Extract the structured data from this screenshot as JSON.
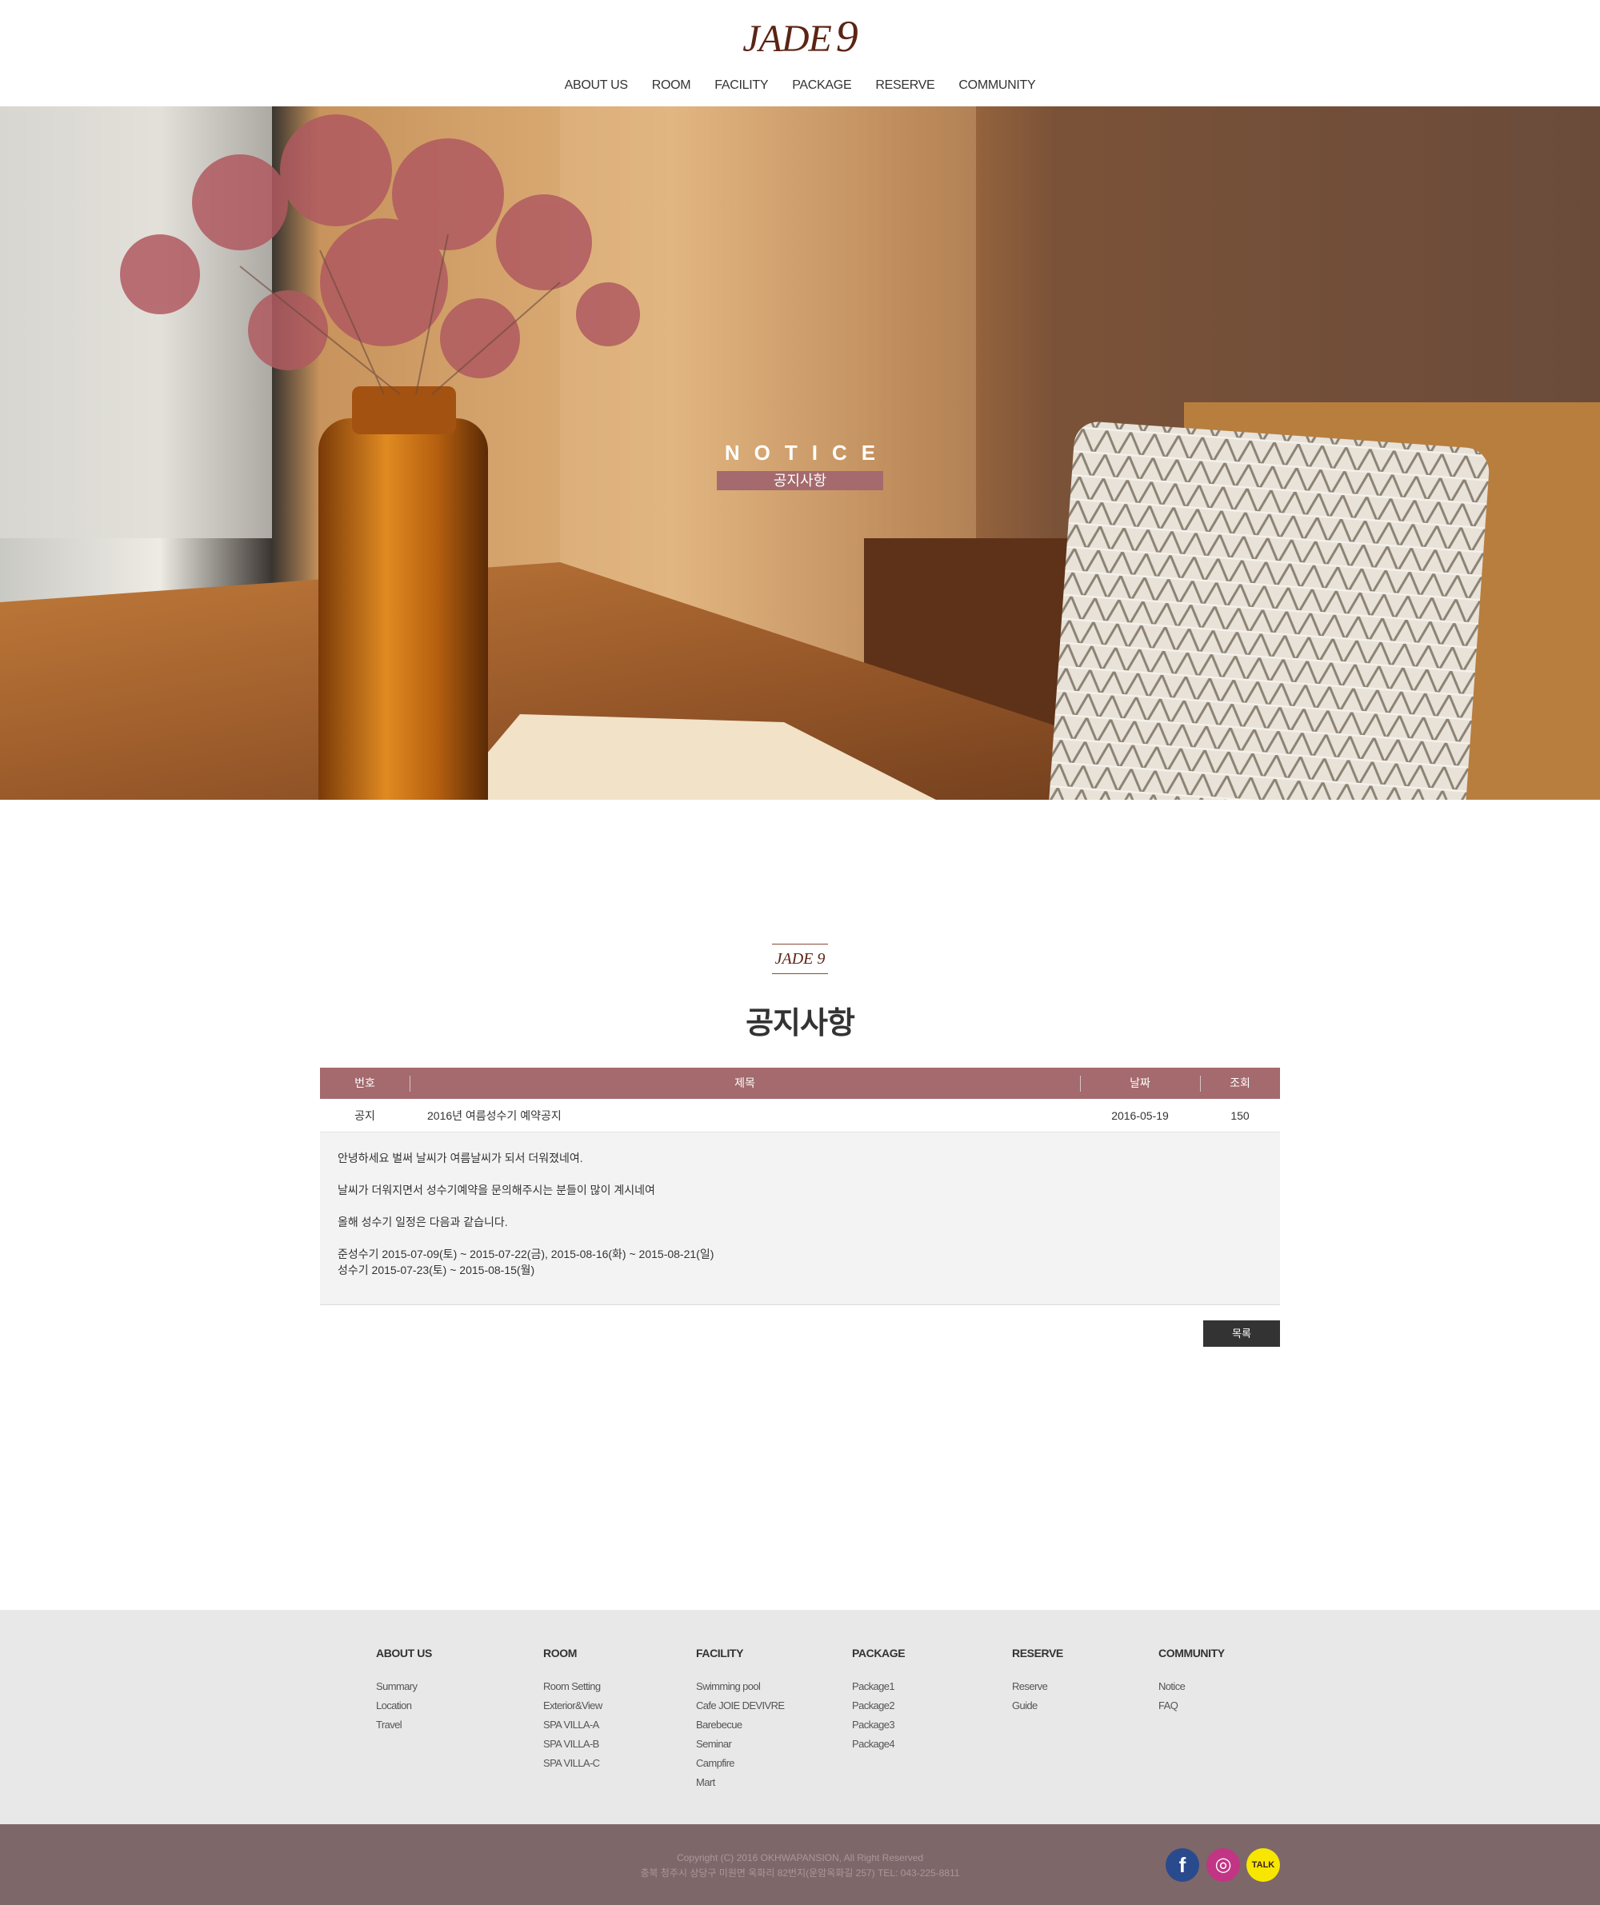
{
  "header": {
    "logo_text": "JADE",
    "logo_number": "9",
    "nav": [
      "ABOUT US",
      "ROOM",
      "FACILITY",
      "PACKAGE",
      "RESERVE",
      "COMMUNITY"
    ]
  },
  "hero": {
    "title": "NOTICE",
    "subtitle": "공지사항"
  },
  "section": {
    "mini_logo": "JADE 9",
    "title": "공지사항"
  },
  "board": {
    "headers": {
      "no": "번호",
      "subject": "제목",
      "date": "날짜",
      "views": "조회"
    },
    "row": {
      "no": "공지",
      "subject": "2016년 여름성수기  예약공지",
      "date": "2016-05-19",
      "views": "150"
    },
    "content": [
      "안녕하세요 벌써 날씨가 여름날씨가 되서 더워졌네여.",
      "날씨가 더워지면서 성수기예약을 문의해주시는 분들이 많이 계시네여",
      "올해 성수기 일정은 다음과 같습니다.",
      "준성수기 2015-07-09(토) ~ 2015-07-22(금), 2015-08-16(화) ~ 2015-08-21(일)",
      "성수기 2015-07-23(토) ~ 2015-08-15(월)"
    ],
    "list_button": "목록"
  },
  "footer": {
    "columns": [
      {
        "title": "ABOUT US",
        "links": [
          "Summary",
          "Location",
          "Travel"
        ]
      },
      {
        "title": "ROOM",
        "links": [
          "Room Setting",
          "Exterior&View",
          "SPA VILLA-A",
          "SPA VILLA-B",
          "SPA VILLA-C"
        ]
      },
      {
        "title": "FACILITY",
        "links": [
          "Swimming pool",
          "Cafe JOIE DEVIVRE",
          "Barebecue",
          "Seminar",
          "Campfire",
          "Mart"
        ]
      },
      {
        "title": "PACKAGE",
        "links": [
          "Package1",
          "Package2",
          "Package3",
          "Package4"
        ]
      },
      {
        "title": "RESERVE",
        "links": [
          "Reserve",
          "Guide"
        ]
      },
      {
        "title": "COMMUNITY",
        "links": [
          "Notice",
          "FAQ"
        ]
      }
    ],
    "copyright": "Copyright (C) 2016 OKHWAPANSION, All Right Reserved",
    "address": "충북 청주시 상당구 미원면 옥화리 82번지(운암옥화길 257) TEL: 043-225-8811",
    "social": [
      {
        "icon": "facebook-icon",
        "glyph": "f",
        "color": "#2a4a8e"
      },
      {
        "icon": "instagram-icon",
        "glyph": "◎",
        "color": "#c13584"
      },
      {
        "icon": "kakaotalk-icon",
        "glyph": "TALK",
        "color": "#f7e600"
      }
    ]
  }
}
